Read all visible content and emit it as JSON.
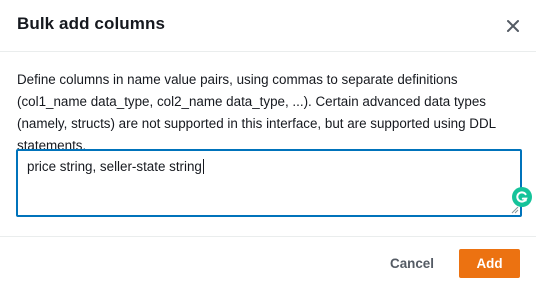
{
  "dialog": {
    "title": "Bulk add columns",
    "description": "Define columns in name value pairs, using commas to separate definitions (col1_name data_type, col2_name data_type, ...). Certain advanced data types (namely, structs) are not supported in this interface, but are supported using DDL statements.",
    "textarea_value": "price string, seller-state string",
    "close_icon": "close-icon",
    "grammarly_icon": "grammarly-icon"
  },
  "footer": {
    "cancel_label": "Cancel",
    "add_label": "Add"
  },
  "colors": {
    "accent": "#0073bb",
    "primary_button": "#ec7211",
    "grammarly": "#15c39a"
  }
}
